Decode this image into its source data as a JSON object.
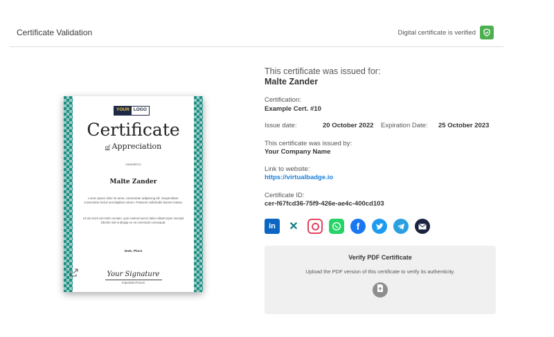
{
  "header": {
    "title": "Certificate Validation",
    "verified_text": "Digital certificate is verified",
    "verified_color": "#4caf50"
  },
  "certificate_preview": {
    "logo_part1": "YOUR",
    "logo_part2": "LOGO",
    "title": "Certificate",
    "subtitle_of": "of",
    "subtitle": "Appreciation",
    "awarded_to": "Awarded to",
    "name": "Malte Zander",
    "lorem1": "Lorem ipsum dolor sit amet, consectetur adipiscing elit. Suspendisse consectetur lectus sed dapibus rutrum. Praesent sollicitudin laoreet massa.",
    "lorem2": "Ut wis enim ad minim veniam, quis nostrud exerci tation ullamcorper suscipit lobortis nisl ut aliquip ex ea commodo consequat.",
    "date_place": "Date, Place",
    "signature": "Your Signature",
    "signer": "Important Person",
    "border_color": "#1e8f82"
  },
  "info": {
    "issued_for_label": "This certificate was issued for:",
    "recipient": "Malte Zander",
    "certification_label": "Certification:",
    "certification": "Example Cert. #10",
    "issue_date_label": "Issue date:",
    "issue_date": "20 October 2022",
    "expiration_label": "Expiration Date:",
    "expiration_date": "25 October 2023",
    "issued_by_label": "This certificate was issued by:",
    "issuer": "Your Company Name",
    "website_label": "Link to website:",
    "website": "https://virtualbadge.io",
    "id_label": "Certificate ID:",
    "id": "cer-f67fcd36-75f9-426e-ae4c-400cd103"
  },
  "share_icons": [
    "linkedin-icon",
    "xing-icon",
    "instagram-icon",
    "whatsapp-icon",
    "facebook-icon",
    "twitter-icon",
    "telegram-icon",
    "email-icon"
  ],
  "verify": {
    "title": "Verify PDF Certificate",
    "description": "Upload the PDF version of this certificate to verify its authenticity."
  },
  "colors": {
    "link": "#1e7fd8",
    "panel_bg": "#f0f0f0"
  }
}
